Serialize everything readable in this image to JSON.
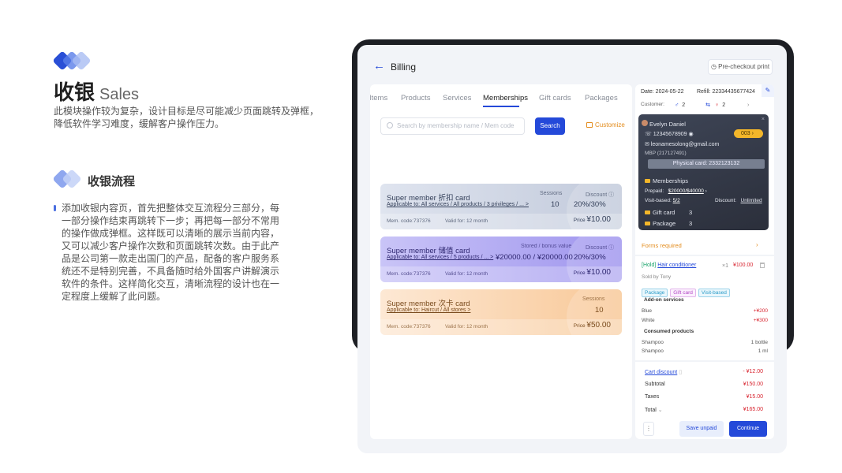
{
  "intro": {
    "title_cn": "收银",
    "title_en": "Sales",
    "description": "此模块操作较为复杂，设计目标是尽可能减少页面跳转及弹框，降低软件学习难度，缓解客户操作压力。",
    "flow_title": "收银流程",
    "flow_text": "添加收银内容页，首先把整体交互流程分三部分，每一部分操作结束再跳转下一步；再把每一部分不常用的操作做成弹框。这样既可以清晰的展示当前内容，又可以减少客户操作次数和页面跳转次数。由于此产品是公司第一款走出国门的产品，配备的客户服务系统还不是特别完善，不具备随时给外国客户讲解演示软件的条件。这样简化交互，清晰流程的设计也在一定程度上缓解了此问题。"
  },
  "app": {
    "back_icon": "←",
    "title": "Billing",
    "precheckout_label": "Pre-checkout print",
    "tabs": [
      "Items",
      "Products",
      "Services",
      "Memberships",
      "Gift cards",
      "Packages"
    ],
    "active_tab": "Memberships",
    "search_placeholder": "Search by membership name / Mem code",
    "search_button": "Search",
    "customize_label": "Customize",
    "cards": [
      {
        "title": "Super member 折扣 card",
        "applicable": "Applicable to: All services / All products / 3 privileges / ... >",
        "hdr1": "Sessions",
        "hdr2": "Discount ⓘ",
        "val1": "10",
        "val2": "20%/30%",
        "mem_code": "Mem. code:737376",
        "valid": "Valid for: 12 month",
        "price_label": "Price",
        "price": "¥10.00"
      },
      {
        "title": "Super member 储值 card",
        "applicable": "Applicable to: All services / 5 products / ... >",
        "hdr1": "Stored / bonus value",
        "hdr2": "Discount ⓘ",
        "val1": "¥20000.00 / ¥20000.00",
        "val2": "20%/30%",
        "mem_code": "Mem. code:737376",
        "valid": "Valid for: 12 month",
        "price_label": "Price",
        "price": "¥10.00"
      },
      {
        "title": "Super member 次卡 card",
        "applicable": "Applicable to: Haircut / All stores >",
        "hdr1": "",
        "hdr2": "Sessions",
        "val1": "",
        "val2": "10",
        "mem_code": "Mem. code:737376",
        "valid": "Valid for: 12 month",
        "price_label": "Price",
        "price": "¥50.00"
      }
    ],
    "right": {
      "date": "Date: 2024-05-22",
      "refill": "Refill: 22334435677424",
      "customer_label": "Customer:",
      "male_icon": "♂",
      "male_count": "2",
      "swap_icon": "⇆",
      "female_icon": "♀",
      "female_count": "2",
      "next_icon": "›",
      "member": {
        "close_icon": "×",
        "name": "Evelyn Daniel",
        "phone": "☏ 12345678909 ◉",
        "badge": "003  ›",
        "email": "✉ leonamesolong@gmail.com",
        "mbp": "MBP (217127491)",
        "physical_card": "Physical card: 2332123132",
        "memberships_label": "Memberships",
        "prepaid_label": "Prepaid:",
        "prepaid_value": "$20000/$40000",
        "prepaid_arrow": "›",
        "visit_label": "Visit-based:",
        "visit_value": "5/2",
        "discount_label": "Discount:",
        "discount_value": "Unlimited",
        "gift_label": "Gift card",
        "gift_count": "3",
        "package_label": "Package",
        "package_count": "3"
      },
      "forms_required": "Forms required",
      "forms_arrow": "›",
      "item_hold": "[Hold]",
      "item_name": "Hair conditioner",
      "item_qty": "×1",
      "item_price": "¥100.00",
      "sold_by": "Sold by Tony",
      "tags": [
        "Package",
        "Gift card",
        "Visit-based"
      ],
      "addon_label": "Add-on services",
      "addons": [
        {
          "name": "Blue",
          "value": "+¥200"
        },
        {
          "name": "White",
          "value": "+¥300"
        }
      ],
      "consumed_label": "Consumed products",
      "consumed": [
        {
          "name": "Shampoo",
          "value": "1 bottle"
        },
        {
          "name": "Shampoo",
          "value": "1 ml"
        }
      ],
      "cart_discount_label": "Cart discount",
      "cart_discount_value": "- ¥12.00",
      "subtotal_label": "Subtotal",
      "subtotal_value": "¥150.00",
      "taxes_label": "Taxes",
      "taxes_value": "¥15.00",
      "total_label": "Total",
      "total_chevron": "⌄",
      "total_value": "¥165.00",
      "more_icon": "⋮",
      "save_unpaid": "Save unpaid",
      "continue": "Continue"
    }
  }
}
